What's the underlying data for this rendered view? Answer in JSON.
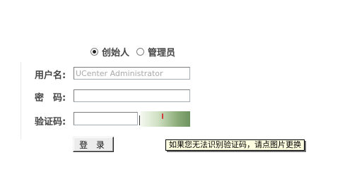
{
  "role_selector": {
    "options": [
      {
        "label": "创始人",
        "checked": true
      },
      {
        "label": "管理员",
        "checked": false
      }
    ]
  },
  "form": {
    "username_label": "用户名:",
    "username_value": "UCenter Administrator",
    "password_label": "密　码:",
    "password_value": "",
    "captcha_label": "验证码:",
    "captcha_value": ""
  },
  "login_button_label": "登 录",
  "captcha_tooltip": "如果您无法识别验证码，请点图片更换",
  "colors": {
    "tooltip_bg": "#ffffe1",
    "captcha_gradient_end": "#6e9360"
  }
}
